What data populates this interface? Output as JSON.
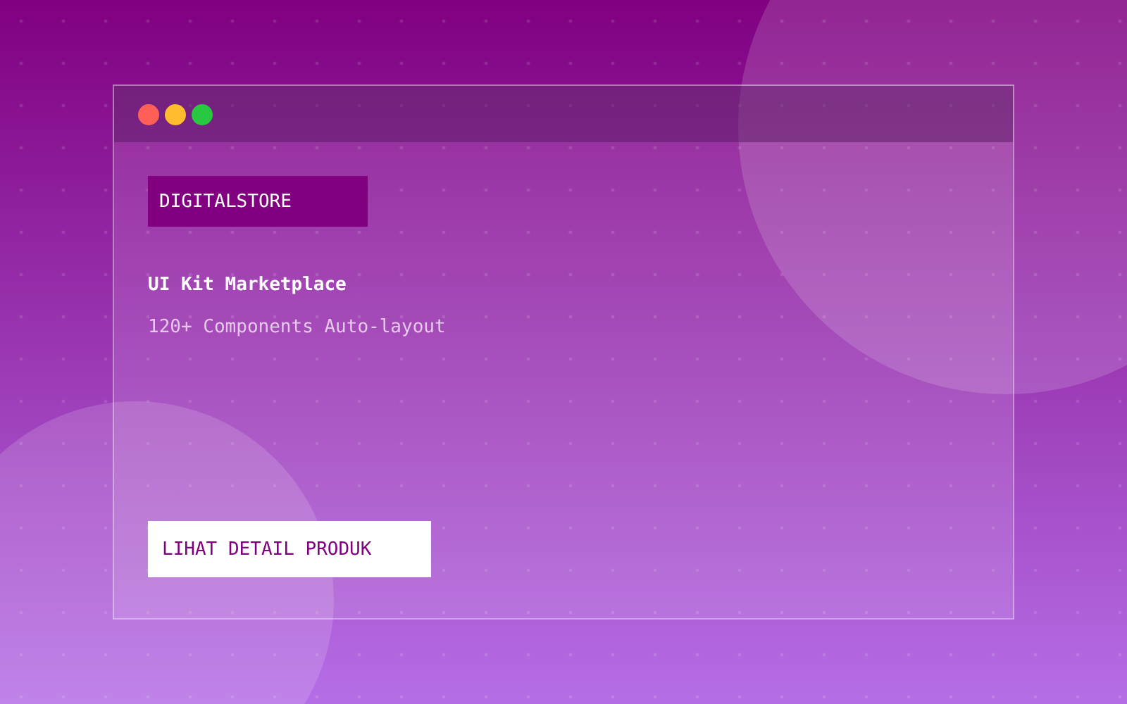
{
  "window": {
    "controls": [
      {
        "color": "#ff5f57"
      },
      {
        "color": "#febc2e"
      },
      {
        "color": "#28c840"
      }
    ]
  },
  "brand": "DIGITALSTORE",
  "title": "UI Kit Marketplace",
  "subtitle": "120+ Components Auto-layout",
  "button": "LIHAT DETAIL PRODUK"
}
